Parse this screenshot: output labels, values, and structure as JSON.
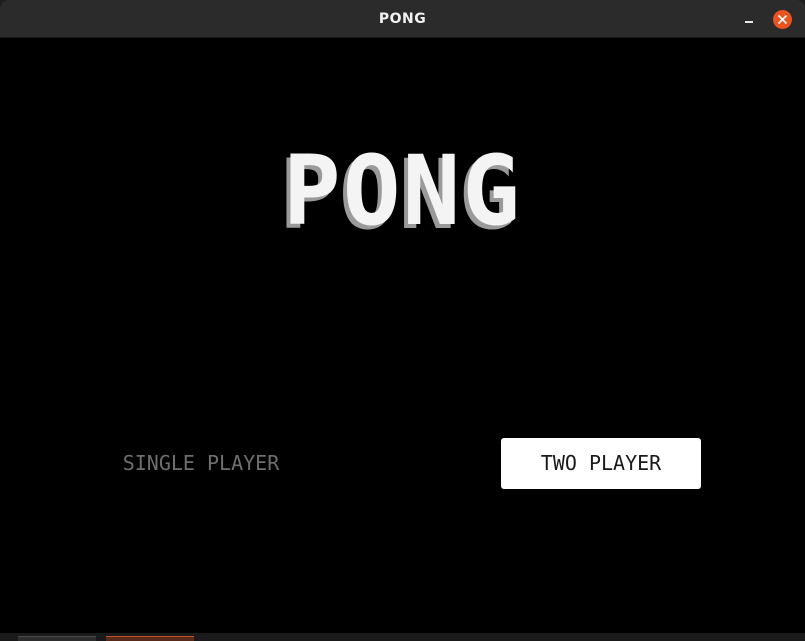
{
  "window": {
    "title": "PONG",
    "accent_close": "#e95420"
  },
  "game": {
    "logo": "PONG",
    "menu": {
      "single_player": "SINGLE PLAYER",
      "two_player": "TWO PLAYER",
      "selected": "TWO PLAYER"
    }
  },
  "icons": {
    "minimize": "minimize-icon",
    "close": "close-icon"
  }
}
